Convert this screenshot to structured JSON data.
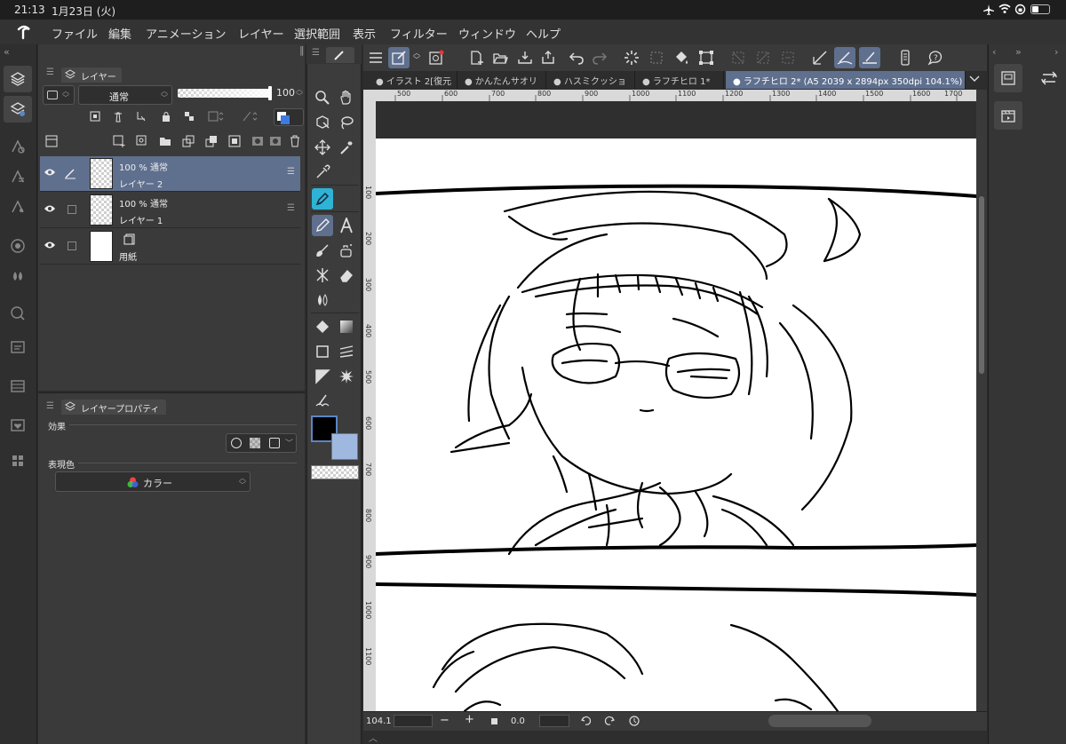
{
  "status": {
    "time": "21:13",
    "date": "1月23日 (火)"
  },
  "menu": [
    "ファイル",
    "編集",
    "アニメーション",
    "レイヤー",
    "選択範囲",
    "表示",
    "フィルター",
    "ウィンドウ",
    "ヘルプ"
  ],
  "layer_panel": {
    "tab_label": "レイヤー",
    "blend_mode": "通常",
    "opacity": "100",
    "layers": [
      {
        "mode_label": "100 %  通常",
        "name": "レイヤー 2",
        "selected": true
      },
      {
        "mode_label": "100 %  通常",
        "name": "レイヤー 1",
        "selected": false
      },
      {
        "mode_label": "",
        "name": "用紙",
        "selected": false
      }
    ]
  },
  "property_panel": {
    "tab_label": "レイヤープロパティ",
    "effect_label": "効果",
    "color_label": "表現色",
    "color_value": "カラー"
  },
  "doc_tabs": [
    {
      "label": "イラスト 2[復元",
      "active": false
    },
    {
      "label": "かんたんサオリ",
      "active": false
    },
    {
      "label": "ハスミクッショ",
      "active": false
    },
    {
      "label": "ラフチヒロ 1*",
      "active": false
    },
    {
      "label": "ラフチヒロ 2* (A5 2039 x 2894px 350dpi 104.1%)",
      "active": true
    }
  ],
  "ruler_h": [
    "500",
    "600",
    "700",
    "800",
    "900",
    "1000",
    "1100",
    "1200",
    "1300",
    "1400",
    "1500",
    "1600",
    "1700"
  ],
  "ruler_v": [
    "100",
    "200",
    "300",
    "400",
    "500",
    "600",
    "700",
    "800",
    "900",
    "1000",
    "1100"
  ],
  "bottom_bar": {
    "zoom": "104.1",
    "minus": "−",
    "plus": "+",
    "rotation": "0.0"
  },
  "colors": {
    "main": "#000000",
    "sub": "#9fb8e0",
    "accent": "#5b86c4",
    "selected_layer": "#5f6f8e"
  }
}
